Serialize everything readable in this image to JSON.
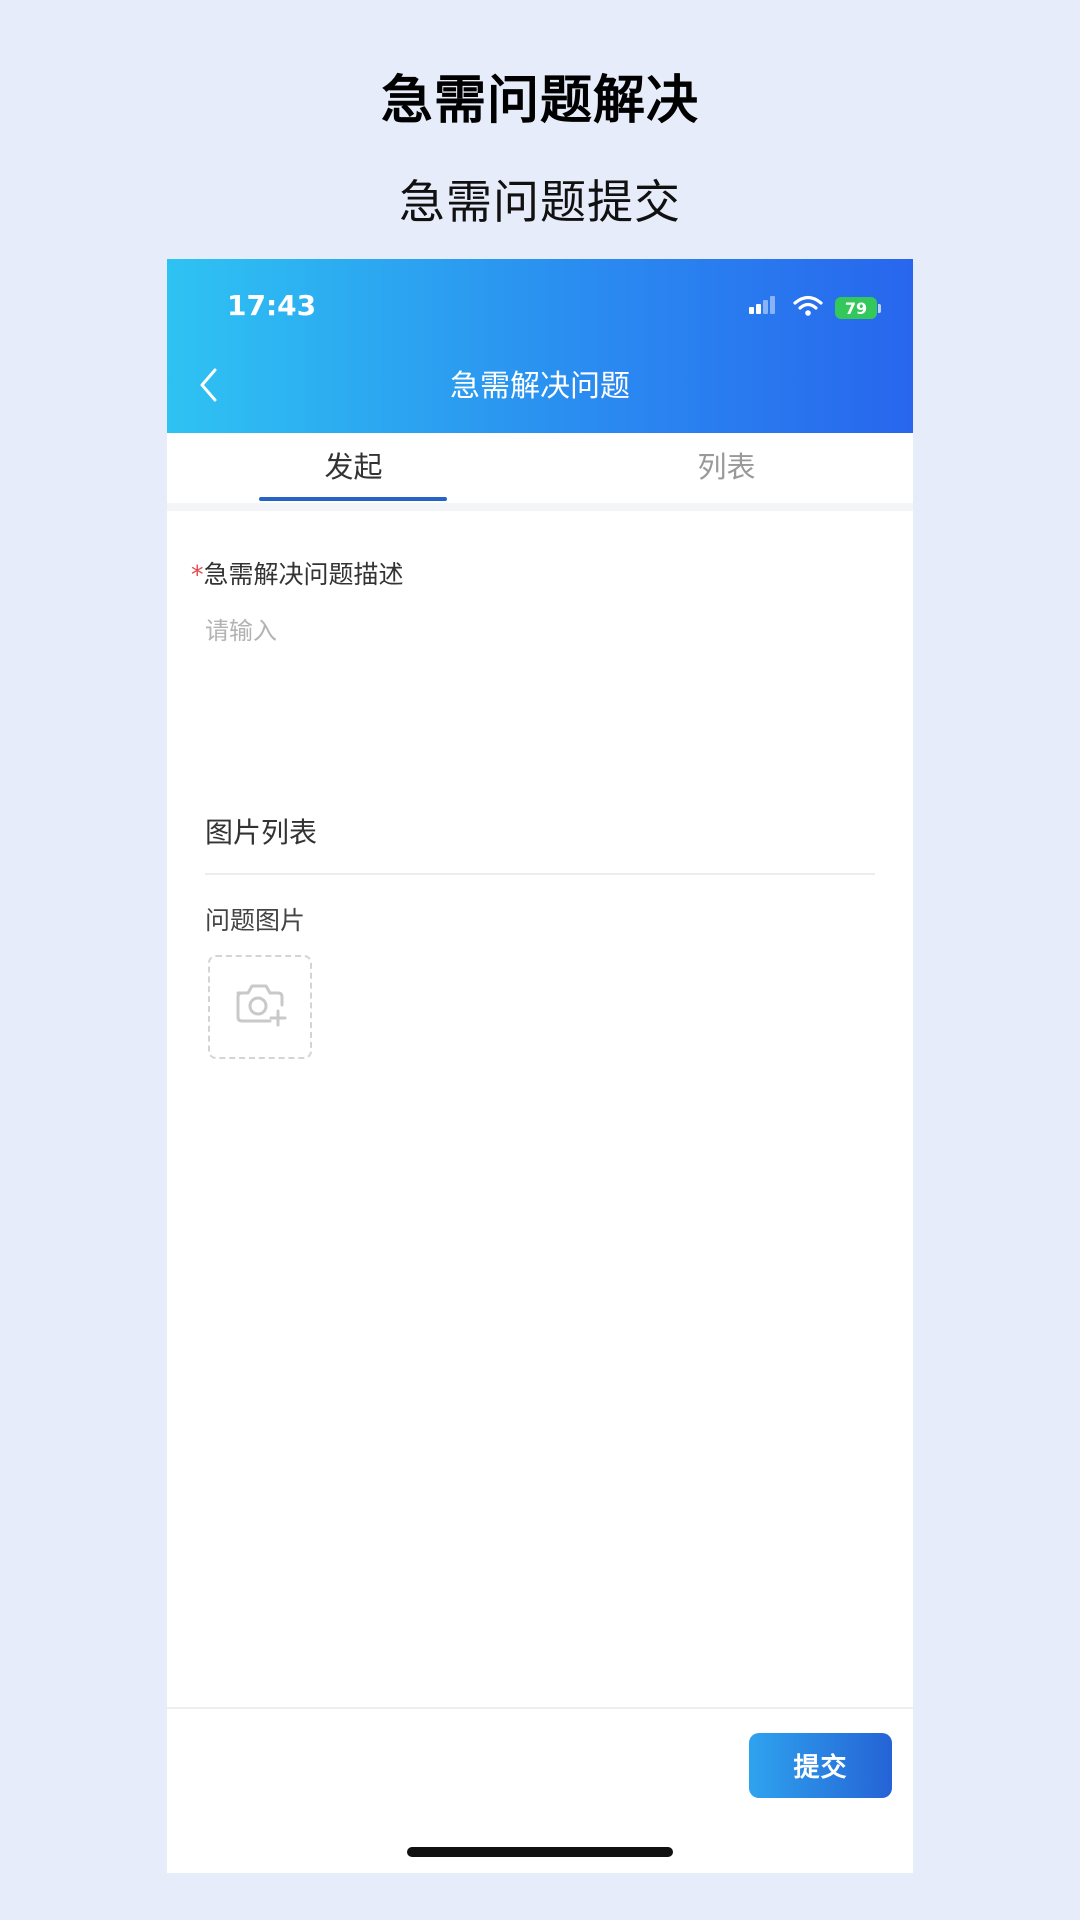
{
  "hero": {
    "title": "急需问题解决",
    "subtitle": "急需问题提交"
  },
  "status_bar": {
    "time": "17:43",
    "battery": "79",
    "icons": [
      "cellular-signal-icon",
      "wifi-icon",
      "battery-charging-icon"
    ]
  },
  "nav": {
    "title": "急需解决问题",
    "back_icon": "chevron-left-icon"
  },
  "tabs": [
    {
      "label": "发起",
      "active": true
    },
    {
      "label": "列表",
      "active": false
    }
  ],
  "form": {
    "required_mark": "*",
    "description_label": "急需解决问题描述",
    "description_placeholder": "请输入",
    "description_value": "",
    "images_section_title": "图片列表",
    "problem_photo_label": "问题图片",
    "upload_icon": "camera-add-icon"
  },
  "footer": {
    "submit_label": "提交"
  },
  "colors": {
    "page_background": "#e7ecfa",
    "header_gradient_start": "#2ec3f2",
    "header_gradient_end": "#2866ee",
    "tab_active_underline": "#2563c7",
    "required_mark": "#e5484d",
    "battery": "#34c759"
  }
}
